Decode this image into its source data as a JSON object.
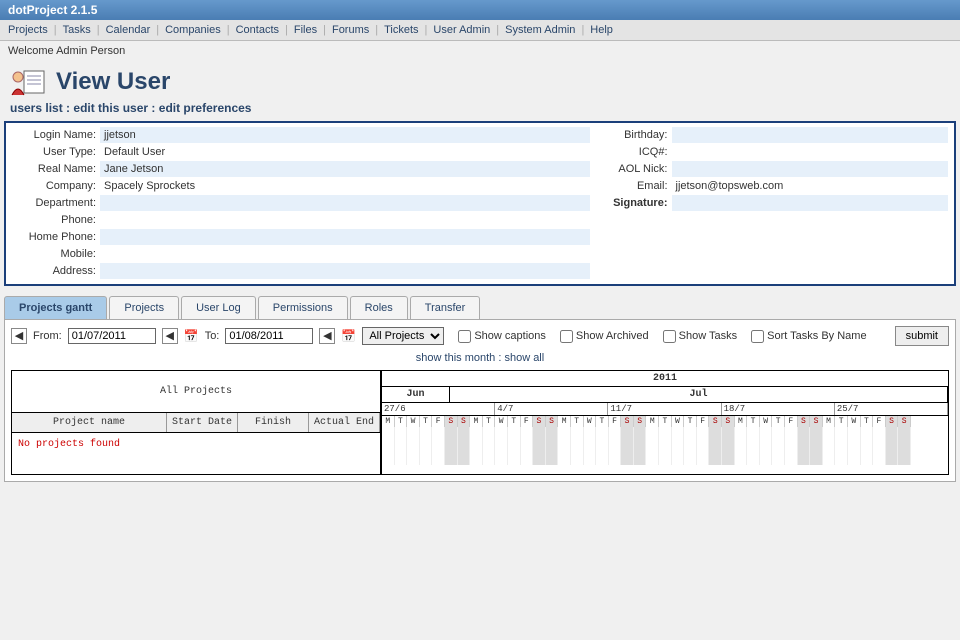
{
  "app_title": "dotProject 2.1.5",
  "menu": [
    "Projects",
    "Tasks",
    "Calendar",
    "Companies",
    "Contacts",
    "Files",
    "Forums",
    "Tickets",
    "User Admin",
    "System Admin",
    "Help"
  ],
  "welcome": "Welcome Admin Person",
  "page_title": "View User",
  "action_links": {
    "users_list": "users list",
    "edit_user": "edit this user",
    "edit_prefs": "edit preferences"
  },
  "user_left": {
    "login_name": {
      "label": "Login Name:",
      "value": "jjetson"
    },
    "user_type": {
      "label": "User Type:",
      "value": "Default User"
    },
    "real_name": {
      "label": "Real Name:",
      "value": "Jane Jetson"
    },
    "company": {
      "label": "Company:",
      "value": "Spacely Sprockets"
    },
    "department": {
      "label": "Department:",
      "value": ""
    },
    "phone": {
      "label": "Phone:",
      "value": ""
    },
    "home_phone": {
      "label": "Home Phone:",
      "value": ""
    },
    "mobile": {
      "label": "Mobile:",
      "value": ""
    },
    "address": {
      "label": "Address:",
      "value": ""
    }
  },
  "user_right": {
    "birthday": {
      "label": "Birthday:",
      "value": ""
    },
    "icq": {
      "label": "ICQ#:",
      "value": ""
    },
    "aol": {
      "label": "AOL Nick:",
      "value": ""
    },
    "email": {
      "label": "Email:",
      "value": "jjetson@topsweb.com"
    },
    "signature": {
      "label": "Signature:",
      "value": ""
    }
  },
  "tabs": [
    "Projects gantt",
    "Projects",
    "User Log",
    "Permissions",
    "Roles",
    "Transfer"
  ],
  "active_tab_index": 0,
  "filter": {
    "from_label": "From:",
    "from_value": "01/07/2011",
    "to_label": "To:",
    "to_value": "01/08/2011",
    "project_select": "All Projects",
    "show_captions": "Show captions",
    "show_archived": "Show Archived",
    "show_tasks": "Show Tasks",
    "sort_by_name": "Sort Tasks By Name",
    "submit": "submit",
    "show_this_month": "show this month",
    "show_all": "show all"
  },
  "gantt": {
    "all_projects": "All Projects",
    "cols": {
      "name": "Project name",
      "start": "Start Date",
      "finish": "Finish",
      "actual": "Actual End"
    },
    "empty": "No projects found",
    "year": "2011",
    "months": [
      {
        "label": "Jun",
        "width": "12%"
      },
      {
        "label": "Jul",
        "width": "88%"
      }
    ],
    "weeks": [
      "27/6",
      "4/7",
      "11/7",
      "18/7",
      "25/7"
    ],
    "day_letters": [
      "M",
      "T",
      "W",
      "T",
      "F",
      "S",
      "S"
    ]
  }
}
